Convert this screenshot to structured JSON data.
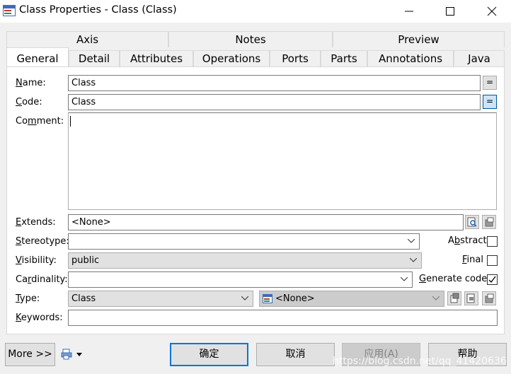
{
  "window": {
    "title": "Class Properties - Class (Class)"
  },
  "tabs": {
    "row1": [
      "Axis",
      "Notes",
      "Preview"
    ],
    "row2": [
      "General",
      "Detail",
      "Attributes",
      "Operations",
      "Ports",
      "Parts",
      "Annotations",
      "Java"
    ],
    "active": "General"
  },
  "form": {
    "name": {
      "label_u": "N",
      "label_rest": "ame:",
      "value": "Class",
      "btn": "="
    },
    "code": {
      "label_u": "C",
      "label_rest": "ode:",
      "value": "Class",
      "btn": "="
    },
    "comment": {
      "label_pre": "Co",
      "label_u": "m",
      "label_rest": "ment:",
      "value": ""
    },
    "extends": {
      "label_u": "E",
      "label_rest": "xtends:",
      "value": "<None>"
    },
    "stereotype": {
      "label_u": "S",
      "label_rest": "tereotype:",
      "value": ""
    },
    "visibility": {
      "label_u": "V",
      "label_rest": "isibility:",
      "value": "public"
    },
    "cardinality": {
      "label_pre": "Ca",
      "label_u": "r",
      "label_rest": "dinality:",
      "value": ""
    },
    "type": {
      "label_u": "T",
      "label_rest": "ype:",
      "value": "Class",
      "classifier": "<None>"
    },
    "keywords": {
      "label_u": "K",
      "label_rest": "eywords:",
      "value": ""
    },
    "abstract": {
      "label_pre": "A",
      "label_u": "b",
      "label_rest": "stract",
      "checked": false
    },
    "final": {
      "label_u": "F",
      "label_rest": "inal",
      "checked": false
    },
    "generate_code": {
      "label_u": "G",
      "label_rest": "enerate code",
      "checked": true
    }
  },
  "footer": {
    "more": "More >>",
    "ok": "确定",
    "cancel": "取消",
    "apply": "应用(A)",
    "help": "帮助"
  },
  "watermark": "https://blog.csdn.net/qq_41420636",
  "colors": {
    "accent": "#0078d7",
    "focus": "#cce4f7"
  }
}
